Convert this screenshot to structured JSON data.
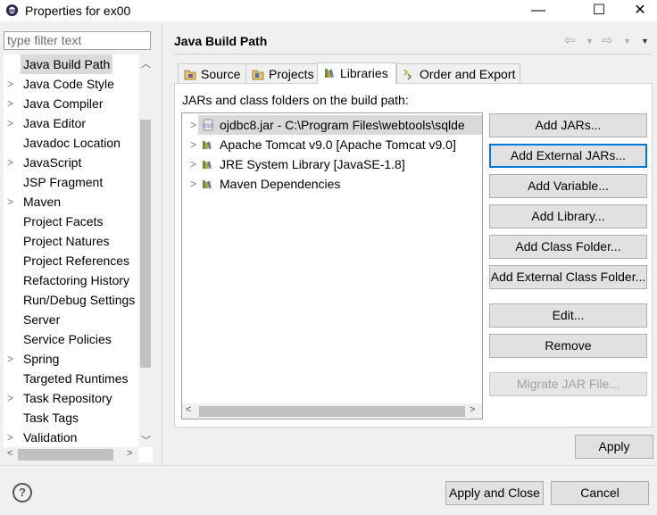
{
  "window": {
    "title": "Properties for ex00",
    "controls": {
      "minimize": "—",
      "maximize": "☐",
      "close": "✕"
    }
  },
  "filter": {
    "placeholder": "type filter text"
  },
  "nav": {
    "items": [
      {
        "label": "Java Build Path",
        "expandable": false,
        "selected": true
      },
      {
        "label": "Java Code Style",
        "expandable": true
      },
      {
        "label": "Java Compiler",
        "expandable": true
      },
      {
        "label": "Java Editor",
        "expandable": true
      },
      {
        "label": "Javadoc Location",
        "expandable": false
      },
      {
        "label": "JavaScript",
        "expandable": true
      },
      {
        "label": "JSP Fragment",
        "expandable": false
      },
      {
        "label": "Maven",
        "expandable": true
      },
      {
        "label": "Project Facets",
        "expandable": false
      },
      {
        "label": "Project Natures",
        "expandable": false
      },
      {
        "label": "Project References",
        "expandable": false
      },
      {
        "label": "Refactoring History",
        "expandable": false
      },
      {
        "label": "Run/Debug Settings",
        "expandable": false
      },
      {
        "label": "Server",
        "expandable": false
      },
      {
        "label": "Service Policies",
        "expandable": false
      },
      {
        "label": "Spring",
        "expandable": true
      },
      {
        "label": "Targeted Runtimes",
        "expandable": false
      },
      {
        "label": "Task Repository",
        "expandable": true
      },
      {
        "label": "Task Tags",
        "expandable": false
      },
      {
        "label": "Validation",
        "expandable": true
      }
    ]
  },
  "page": {
    "title": "Java Build Path",
    "tabs": [
      {
        "label": "Source",
        "icon": "source-folder-icon"
      },
      {
        "label": "Projects",
        "icon": "projects-folder-icon"
      },
      {
        "label": "Libraries",
        "icon": "libraries-icon",
        "active": true
      },
      {
        "label": "Order and Export",
        "icon": "order-export-icon"
      }
    ],
    "build_path_label": "JARs and class folders on the build path:",
    "libraries": [
      {
        "label": "ojdbc8.jar - C:\\Program Files\\webtools\\sqlde",
        "icon": "jar-icon",
        "selected": true
      },
      {
        "label": "Apache Tomcat v9.0 [Apache Tomcat v9.0]",
        "icon": "library-icon"
      },
      {
        "label": "JRE System Library [JavaSE-1.8]",
        "icon": "library-icon"
      },
      {
        "label": "Maven Dependencies",
        "icon": "library-icon"
      }
    ],
    "buttons": {
      "add_jars": "Add JARs...",
      "add_external_jars": "Add External JARs...",
      "add_variable": "Add Variable...",
      "add_library": "Add Library...",
      "add_class_folder": "Add Class Folder...",
      "add_external_class_folder": "Add External Class Folder...",
      "edit": "Edit...",
      "remove": "Remove",
      "migrate_jar": "Migrate JAR File...",
      "apply": "Apply"
    }
  },
  "footer": {
    "apply_and_close": "Apply and Close",
    "cancel": "Cancel",
    "help": "?"
  }
}
